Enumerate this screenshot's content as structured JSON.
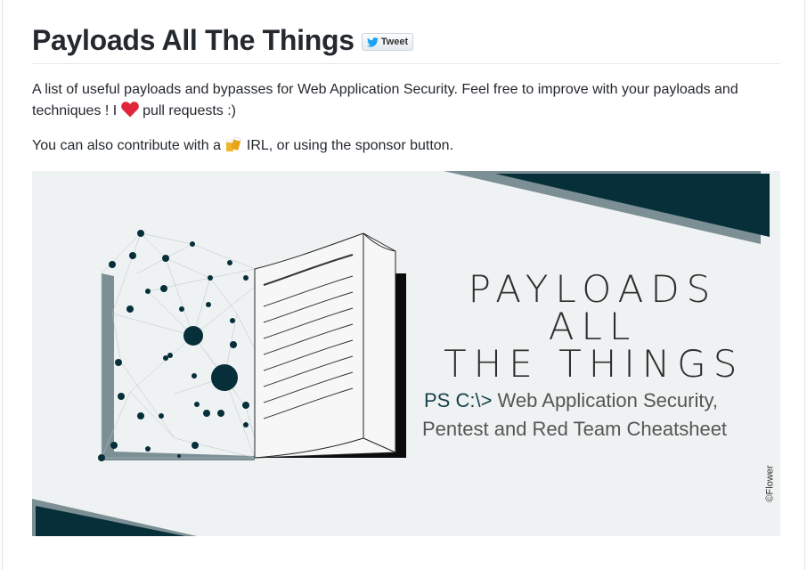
{
  "header": {
    "title": "Payloads All The Things",
    "tweet_label": "Tweet"
  },
  "intro": {
    "line1_text": "A list of useful payloads and bypasses for Web Application Security. Feel free to improve with your payloads and techniques ! I ",
    "heart_icon": "heart-icon",
    "line1_suffix": " pull requests :)",
    "line2_prefix": "You can also contribute with a ",
    "beer_icon": "beer-icon",
    "line2_suffix": " IRL, or using the sponsor button."
  },
  "banner": {
    "title_line1": "PAYLOADS",
    "title_line2": "ALL",
    "title_line3": "THE THINGS",
    "subtitle_prefix": "PS C:\\>",
    "subtitle_line1": " Web Application Security,",
    "subtitle_line2": "Pentest and Red Team Cheatsheet",
    "credit": "©Flower",
    "colors": {
      "dark_teal": "#062f3a",
      "grey_teal": "#7c8f95",
      "background": "#eff2f2"
    }
  }
}
